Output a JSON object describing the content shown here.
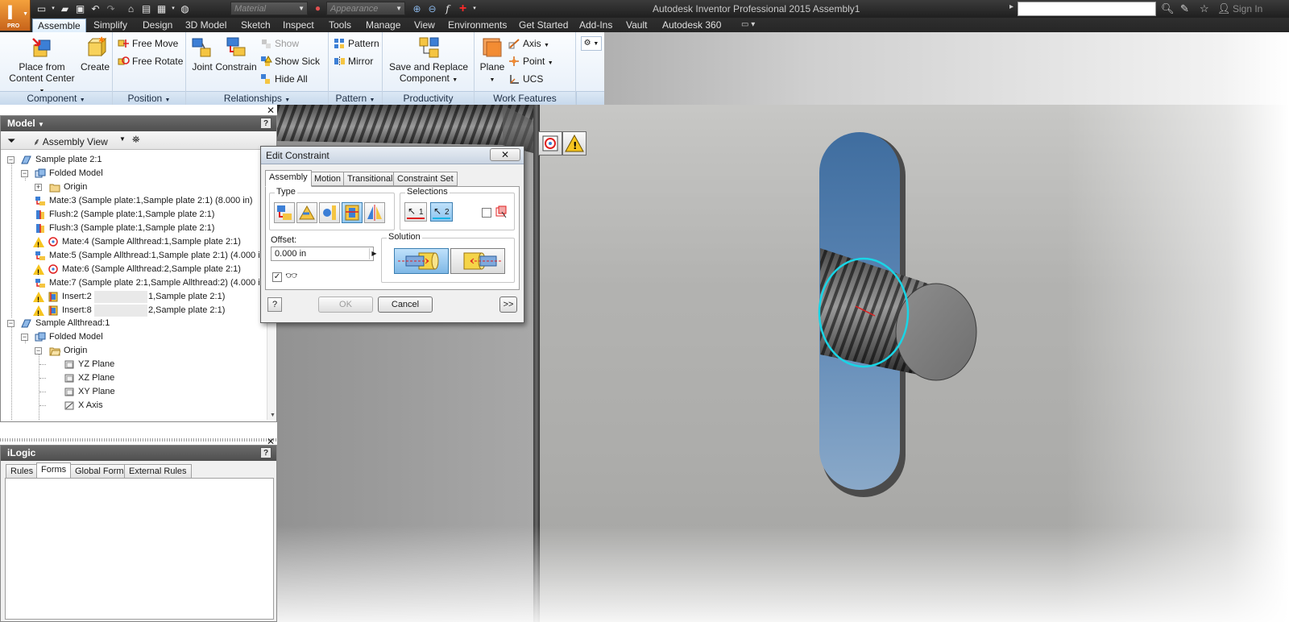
{
  "app": {
    "title": "Autodesk Inventor Professional 2015    Assembly1",
    "logo_badge": "PRO",
    "material_placeholder": "Material",
    "appearance_placeholder": "Appearance",
    "sign_in": "Sign In"
  },
  "tabs": [
    "Assemble",
    "Simplify",
    "Design",
    "3D Model",
    "Sketch",
    "Inspect",
    "Tools",
    "Manage",
    "View",
    "Environments",
    "Get Started",
    "Add-Ins",
    "Vault",
    "Autodesk 360"
  ],
  "active_tab": "Assemble",
  "ribbon": {
    "component": {
      "label": "Component",
      "place_line1": "Place from",
      "place_line2": "Content Center",
      "create": "Create"
    },
    "position": {
      "label": "Position",
      "free_move": "Free Move",
      "free_rotate": "Free Rotate"
    },
    "relationships": {
      "label": "Relationships",
      "joint": "Joint",
      "constrain": "Constrain",
      "show": "Show",
      "show_sick": "Show Sick",
      "hide_all": "Hide All"
    },
    "pattern": {
      "label": "Pattern",
      "pattern": "Pattern",
      "mirror": "Mirror"
    },
    "productivity": {
      "label": "Productivity",
      "save_line1": "Save and Replace",
      "save_line2": "Component"
    },
    "work_features": {
      "label": "Work Features",
      "plane": "Plane",
      "axis": "Axis",
      "point": "Point",
      "ucs": "UCS"
    }
  },
  "browser": {
    "title": "Model",
    "view": "Assembly View",
    "help": "?",
    "nodes": [
      {
        "text": "Sample plate 2:1"
      },
      {
        "text": "Folded Model"
      },
      {
        "text": "Origin"
      },
      {
        "text": "Mate:3 (Sample plate:1,Sample plate 2:1) (8.000 in)"
      },
      {
        "text": "Flush:2 (Sample plate:1,Sample plate 2:1)"
      },
      {
        "text": "Flush:3 (Sample plate:1,Sample plate 2:1)"
      },
      {
        "text": "Mate:4 (Sample Allthread:1,Sample plate 2:1)"
      },
      {
        "text": "Mate:5 (Sample Allthread:1,Sample plate 2:1) (4.000 in)"
      },
      {
        "text": "Mate:6 (Sample Allthread:2,Sample plate 2:1)"
      },
      {
        "text": "Mate:7 (Sample plate 2:1,Sample Allthread:2) (4.000 in)"
      },
      {
        "text": "Insert:2",
        "tail": "1,Sample plate 2:1)"
      },
      {
        "text": "Insert:8",
        "tail": "2,Sample plate 2:1)"
      },
      {
        "text": "Sample Allthread:1"
      },
      {
        "text": "Folded Model"
      },
      {
        "text": "Origin"
      },
      {
        "text": "YZ Plane"
      },
      {
        "text": "XZ Plane"
      },
      {
        "text": "XY Plane"
      },
      {
        "text": "X Axis"
      }
    ]
  },
  "ilogic": {
    "title": "iLogic",
    "help": "?",
    "tabs": [
      "Rules",
      "Forms",
      "Global Forms",
      "External Rules"
    ],
    "active_tab": "Forms"
  },
  "dialog": {
    "title": "Edit Constraint",
    "tabs": [
      "Assembly",
      "Motion",
      "Transitional",
      "Constraint Set"
    ],
    "active_tab": "Assembly",
    "type_label": "Type",
    "selections_label": "Selections",
    "sel1": "1",
    "sel2": "2",
    "offset_label": "Offset:",
    "offset_value": "0.000 in",
    "solution_label": "Solution",
    "help": "?",
    "ok": "OK",
    "cancel": "Cancel",
    "more": ">>"
  }
}
